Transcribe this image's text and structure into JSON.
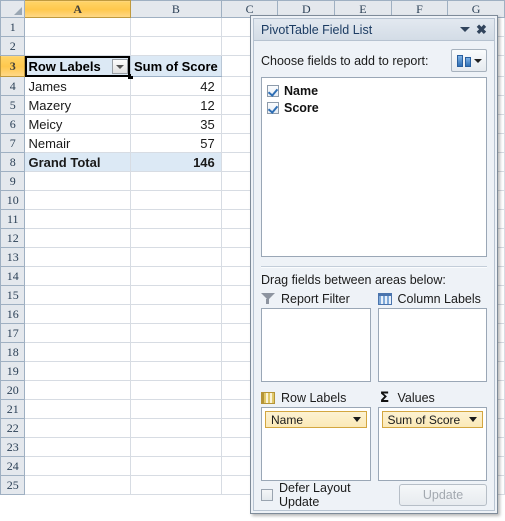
{
  "spreadsheet": {
    "columns": [
      "A",
      "B",
      "C",
      "D",
      "E",
      "F",
      "G"
    ],
    "active_column": "A",
    "active_row": "3",
    "rows": [
      "1",
      "2",
      "3",
      "4",
      "5",
      "6",
      "7",
      "8",
      "9",
      "10",
      "11",
      "12",
      "13",
      "14",
      "15",
      "16",
      "17",
      "18",
      "19",
      "20",
      "21",
      "22",
      "23",
      "24",
      "25"
    ],
    "pivot": {
      "header_row_label": "Row Labels",
      "header_value_label": "Sum of Score",
      "filter_icon": "filter-dropdown-icon",
      "data_rows": [
        {
          "label": "James",
          "value": "42"
        },
        {
          "label": "Mazery",
          "value": "12"
        },
        {
          "label": "Meicy",
          "value": "35"
        },
        {
          "label": "Nemair",
          "value": "57"
        }
      ],
      "total_label": "Grand Total",
      "total_value": "146"
    }
  },
  "panel": {
    "title": "PivotTable Field List",
    "minimize_icon": "chevron-down-icon",
    "close_icon": "close-icon",
    "choose_label": "Choose fields to add to report:",
    "view_button_icon": "field-list-layout-icon",
    "view_button_dropdown_icon": "chevron-down-icon",
    "fields": [
      {
        "name": "Name",
        "checked": true
      },
      {
        "name": "Score",
        "checked": true
      }
    ],
    "drag_label": "Drag fields between areas below:",
    "areas": [
      {
        "key": "report_filter",
        "label": "Report Filter",
        "icon": "funnel-icon",
        "items": []
      },
      {
        "key": "column_labels",
        "label": "Column Labels",
        "icon": "column-grid-icon",
        "items": []
      },
      {
        "key": "row_labels",
        "label": "Row Labels",
        "icon": "row-grid-icon",
        "items": [
          {
            "name": "Name"
          }
        ]
      },
      {
        "key": "values",
        "label": "Values",
        "icon": "sigma-icon",
        "items": [
          {
            "name": "Sum of Score"
          }
        ]
      }
    ],
    "defer_label": "Defer Layout Update",
    "defer_checked": false,
    "update_label": "Update",
    "update_enabled": false
  },
  "colors": {
    "accent_gold": "#ffc84d",
    "pivot_fill": "#dce9f5",
    "panel_bg": "#eef2f7",
    "field_pill": "#fbe9b7"
  }
}
